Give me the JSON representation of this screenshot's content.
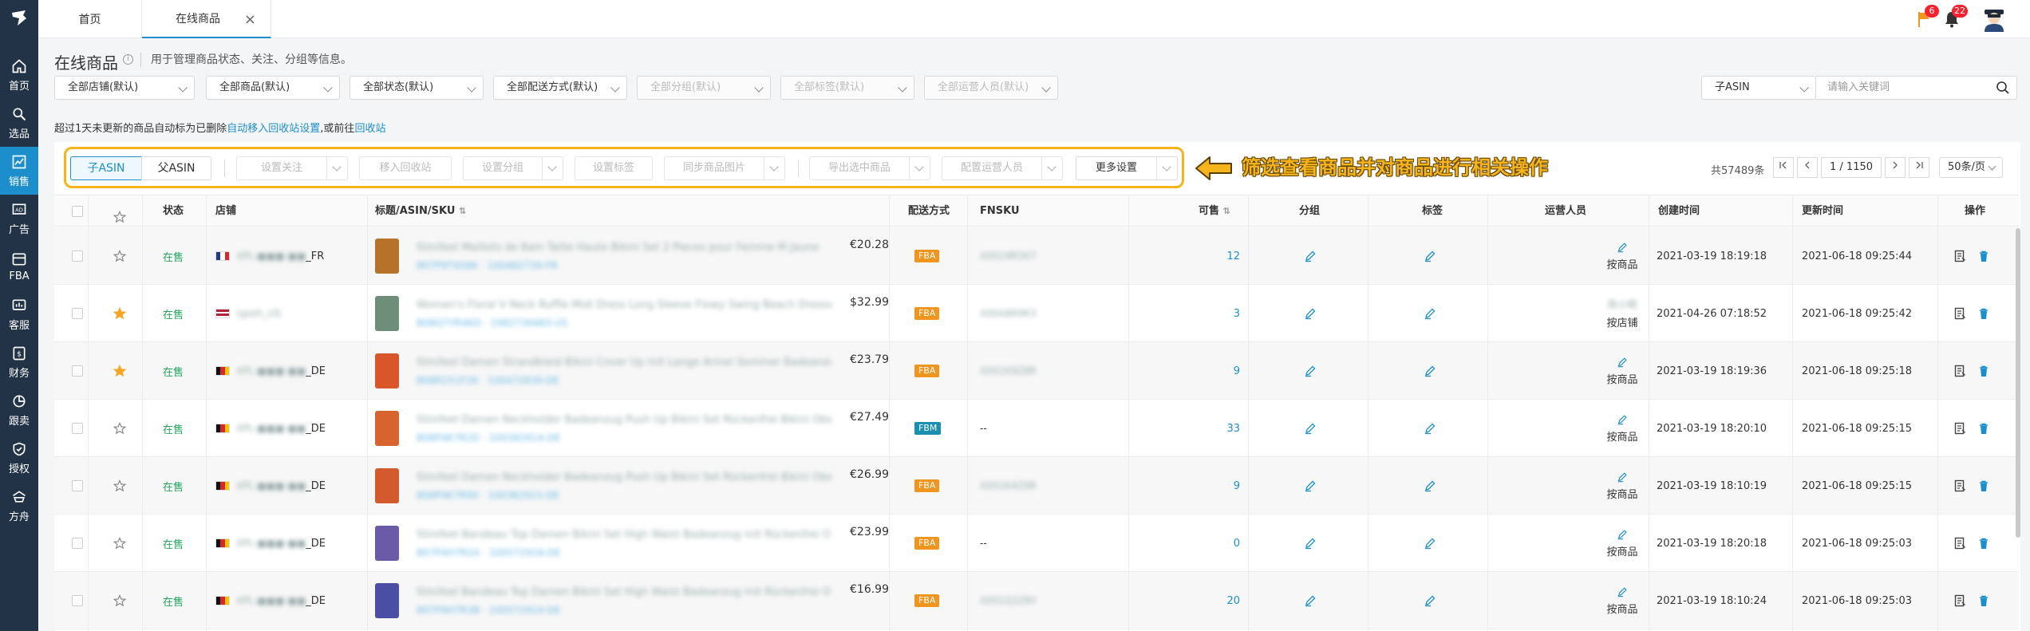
{
  "sidebar": {
    "items": [
      {
        "label": "首页",
        "icon": "home-icon"
      },
      {
        "label": "选品",
        "icon": "search-icon"
      },
      {
        "label": "销售",
        "icon": "trend-chart-icon",
        "active": true
      },
      {
        "label": "广告",
        "icon": "ad-icon"
      },
      {
        "label": "FBA",
        "icon": "fba-icon"
      },
      {
        "label": "客服",
        "icon": "chat-icon"
      },
      {
        "label": "财务",
        "icon": "finance-icon"
      },
      {
        "label": "跟卖",
        "icon": "pie-icon"
      },
      {
        "label": "授权",
        "icon": "shield-icon"
      },
      {
        "label": "方舟",
        "icon": "ark-icon"
      }
    ]
  },
  "tabs": [
    {
      "label": "首页"
    },
    {
      "label": "在线商品",
      "close": "×"
    }
  ],
  "top_right": {
    "flag_count": "6",
    "bell_count": "22"
  },
  "page": {
    "title": "在线商品",
    "info_icon": "i",
    "description": "用于管理商品状态、关注、分组等信息。"
  },
  "filters": [
    {
      "label": "全部店铺(默认)",
      "enabled": true
    },
    {
      "label": "全部商品(默认)",
      "enabled": true
    },
    {
      "label": "全部状态(默认)",
      "enabled": true
    },
    {
      "label": "全部配送方式(默认)",
      "enabled": true
    },
    {
      "label": "全部分组(默认)",
      "enabled": false
    },
    {
      "label": "全部标签(默认)",
      "enabled": false
    },
    {
      "label": "全部运营人员(默认)",
      "enabled": false
    }
  ],
  "search": {
    "field": "子ASIN",
    "placeholder": "请输入关键词"
  },
  "notice": {
    "text": "超过1天未更新的商品自动标为已删除",
    "link1": "自动移入回收站设置",
    "mid": ",或前往",
    "link2": "回收站"
  },
  "toolbar": {
    "seg_child": "子ASIN",
    "seg_parent": "父ASIN",
    "buttons": {
      "set_follow": "设置关注",
      "move_recycle": "移入回收站",
      "set_group": "设置分组",
      "set_tag": "设置标签",
      "sync_images": "同步商品图片",
      "export": "导出选中商品",
      "assign_operator": "配置运营人员",
      "more": "更多设置"
    }
  },
  "annotation": "筛选查看商品并对商品进行相关操作",
  "pagination": {
    "total": "共57489条",
    "current": "1",
    "pages": "/ 1150",
    "per_page": "50条/页"
  },
  "table": {
    "headers": {
      "status": "状态",
      "store": "店铺",
      "title": "标题/ASIN/SKU",
      "fulfillment": "配送方式",
      "fnsku": "FNSKU",
      "sellable": "可售",
      "group": "分组",
      "tag": "标签",
      "operator": "运营人员",
      "created": "创建时间",
      "updated": "更新时间",
      "actions": "操作"
    },
    "rows": [
      {
        "starred": false,
        "status": "在售",
        "store_blur": "XPL-■■■-■■",
        "market": "_FR",
        "country": "fr",
        "title_blur": "Slimfeel Maillots de Bain Taille Haute Bikini Set 2 Pieces pour Femme M Jaune",
        "asin_blur": "B07P9T4X8K · 100482739-FR",
        "price": "€20.28",
        "fulfillment": "FBA",
        "fnsku": "X0019R5K7",
        "fnsku_blur": true,
        "sellable": "12",
        "operator": "按商品",
        "operator_top": "",
        "created": "2021-03-19 18:19:18",
        "updated": "2021-06-18 09:25:44",
        "thumb": "#b7722a"
      },
      {
        "starred": true,
        "status": "在售",
        "store_blur": "rgseh_US",
        "market": "",
        "country": "us",
        "title_blur": "Women's Floral V Neck Ruffle Midi Dress Long Sleeve Flowy Swing Beach Dresses",
        "asin_blur": "B08Q7YR4KD · 1982739483-US",
        "price": "$32.99",
        "fulfillment": "FBA",
        "fnsku": "X00A8R9K3",
        "fnsku_blur": true,
        "sellable": "3",
        "operator": "按店铺",
        "operator_top": "陈小明",
        "created": "2021-04-26 07:18:52",
        "updated": "2021-06-18 09:25:42",
        "thumb": "#6f8e7a"
      },
      {
        "starred": true,
        "status": "在售",
        "store_blur": "XPL-■■■-■■",
        "market": "_DE",
        "country": "de",
        "title_blur": "Slimfeel Damen Strandkleid Bikini Cover Up mit Lange Armel Sommer Badeanzug",
        "asin_blur": "B08R2X1F2K · 100472839-DE",
        "price": "€23.79",
        "fulfillment": "FBA",
        "fnsku": "X001K9Z8R",
        "fnsku_blur": true,
        "sellable": "9",
        "operator": "按商品",
        "operator_top": "",
        "created": "2021-03-19 18:19:36",
        "updated": "2021-06-18 09:25:18",
        "thumb": "#d9552a"
      },
      {
        "starred": false,
        "status": "在售",
        "store_blur": "XPL-■■■-■■",
        "market": "_DE",
        "country": "de",
        "title_blur": "Slimfeel Damen Neckholder Badeanzug Push Up Bikini Set Rückenfrei Bikini Oberteil",
        "asin_blur": "B08P4K7R2D · 100382914-DE",
        "price": "€27.49",
        "fulfillment": "FBM",
        "fnsku": "--",
        "fnsku_blur": false,
        "sellable": "33",
        "operator": "按商品",
        "operator_top": "",
        "created": "2021-03-19 18:20:10",
        "updated": "2021-06-18 09:25:15",
        "thumb": "#d8632f"
      },
      {
        "starred": false,
        "status": "在售",
        "store_blur": "XPL-■■■-■■",
        "market": "_DE",
        "country": "de",
        "title_blur": "Slimfeel Damen Neckholder Badeanzug Push Up Bikini Set Rückenfrei Bikini Oberteil",
        "asin_blur": "B08P4K7R9X · 100382915-DE",
        "price": "€26.99",
        "fulfillment": "FBA",
        "fnsku": "X001K4Z9R",
        "fnsku_blur": true,
        "sellable": "9",
        "operator": "按商品",
        "operator_top": "",
        "created": "2021-03-19 18:10:19",
        "updated": "2021-06-18 09:25:15",
        "thumb": "#d35a2d"
      },
      {
        "starred": false,
        "status": "在售",
        "store_blur": "XPL-■■■-■■",
        "market": "_DE",
        "country": "de",
        "title_blur": "Slimfeel Bandeau Top Damen Bikini Set High Waist Badeanzug mit Rückenfrei Oberteil",
        "asin_blur": "B07P4H7R2A · 100572918-DE",
        "price": "€23.99",
        "fulfillment": "FBA",
        "fnsku": "--",
        "fnsku_blur": false,
        "sellable": "0",
        "operator": "按商品",
        "operator_top": "",
        "created": "2021-03-19 18:20:18",
        "updated": "2021-06-18 09:25:03",
        "thumb": "#6a5aa8"
      },
      {
        "starred": false,
        "status": "在售",
        "store_blur": "XPL-■■■-■■",
        "market": "_DE",
        "country": "de",
        "title_blur": "Slimfeel Bandeau Top Damen Bikini Set High Waist Badeanzug mit Rückenfrei Oberteil",
        "asin_blur": "B07P4H7R3B · 100572919-DE",
        "price": "€16.99",
        "fulfillment": "FBA",
        "fnsku": "X001Q2Z8Y",
        "fnsku_blur": true,
        "sellable": "20",
        "operator": "按商品",
        "operator_top": "",
        "created": "2021-03-19 18:10:24",
        "updated": "2021-06-18 09:25:03",
        "thumb": "#4a4fa5"
      }
    ]
  }
}
